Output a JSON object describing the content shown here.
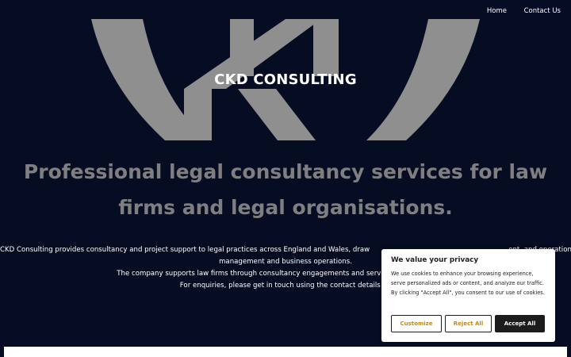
{
  "nav": {
    "home": "Home",
    "contact": "Contact Us"
  },
  "brand": {
    "title": "CKD CONSULTING",
    "logo_color": "#8f8f90"
  },
  "hero": {
    "headline": "Professional legal consultancy services for law firms and legal organisations."
  },
  "body": {
    "line1": "CKD Consulting provides consultancy and project support to legal practices across England and Wales, draw",
    "line1b": "ent, and operational",
    "line2": "management and business operations.",
    "line3": "The company supports law firms through consultancy engagements and serves as the business ve",
    "line4": "For enquiries, please get in touch using the contact details be"
  },
  "cookie": {
    "title": "We value your privacy",
    "text": "We use cookies to enhance your browsing experience, serve personalized ads or content, and analyze our traffic. By clicking \"Accept All\", you consent to our use of cookies.",
    "customize": "Customize",
    "reject": "Reject All",
    "accept": "Accept All"
  },
  "colors": {
    "background": "#060d22",
    "accent": "#c98a00"
  }
}
